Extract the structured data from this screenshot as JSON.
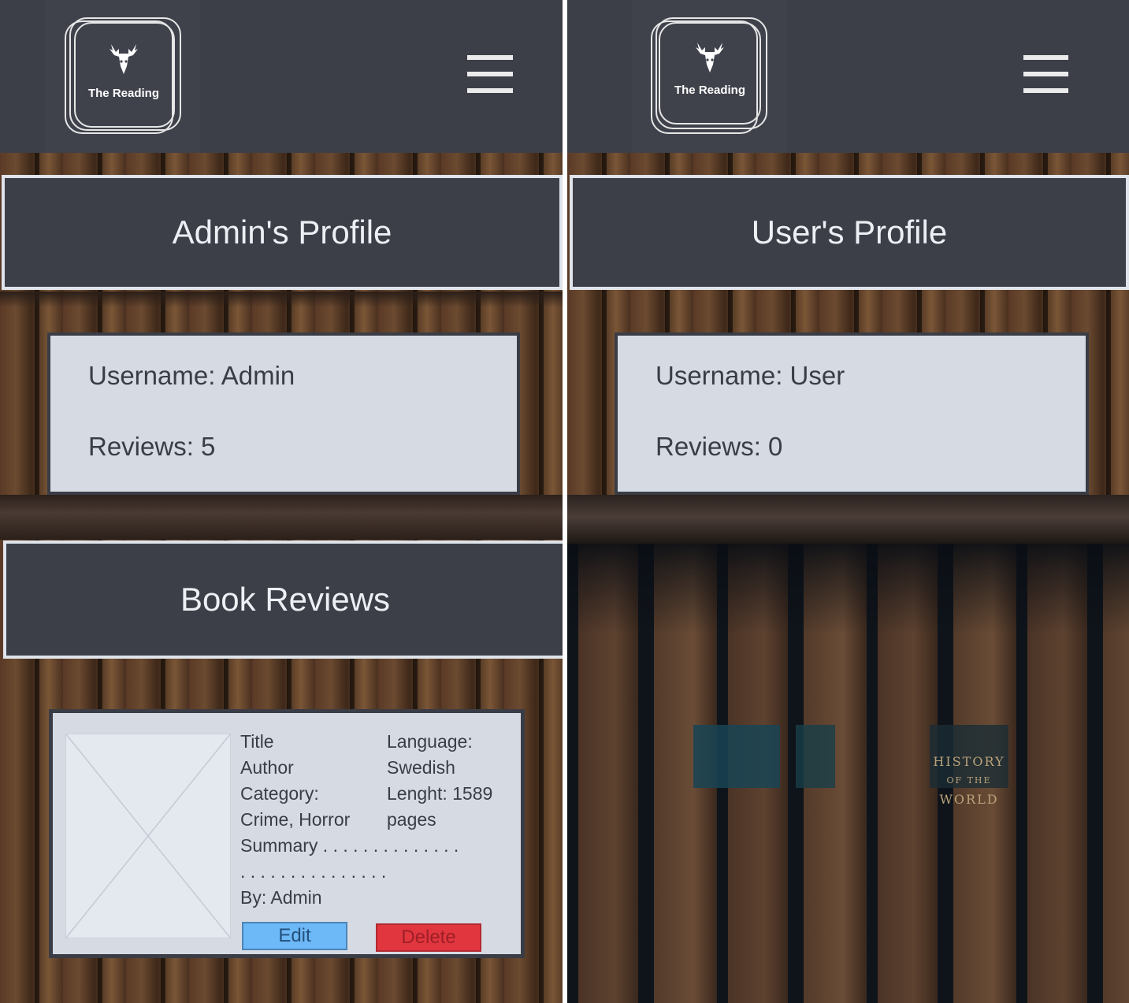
{
  "brand": {
    "logo_text": "The Reading",
    "logo_icon": "deer-icon"
  },
  "admin_screen": {
    "title": "Admin's Profile",
    "profile": {
      "username": "Username: Admin",
      "reviews": "Reviews: 5"
    },
    "reviews_title": "Book Reviews",
    "review": {
      "title": "Title",
      "author": "Author",
      "category_label": "Category:",
      "category_value": "Crime, Horror",
      "summary": "Summary . . . . . . . . . . . . . .",
      "summary_cont": ". . . . . . . . . . . . . . .",
      "language_label": "Language:",
      "language_value": "Swedish",
      "length_label": "Lenght: 1589",
      "length_value": "pages",
      "by": "By: Admin",
      "edit_label": "Edit",
      "delete_label": "Delete"
    }
  },
  "user_screen": {
    "title": "User's Profile",
    "profile": {
      "username": "Username: User",
      "reviews": "Reviews: 0"
    },
    "spines": [
      "HISTORY",
      "OF THE",
      "WORLD"
    ]
  },
  "colors": {
    "header_bg": "#3d3f48",
    "card_bg": "#d6dae2",
    "edit_button": "#6db8f7",
    "delete_button": "#e2363f"
  },
  "icons": {
    "menu": "hamburger-menu-icon",
    "image": "image-placeholder-icon"
  }
}
